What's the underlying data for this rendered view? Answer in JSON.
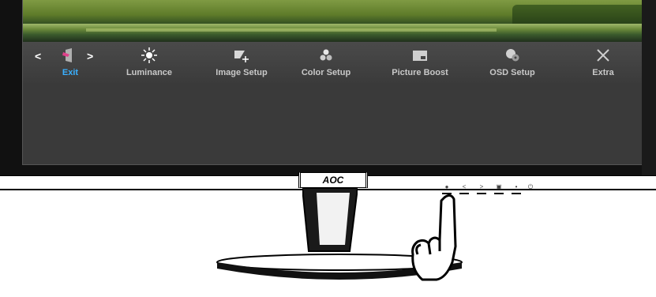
{
  "osd": {
    "menu_items": [
      {
        "label": "Exit",
        "icon": "exit-icon",
        "active": true
      },
      {
        "label": "Luminance",
        "icon": "luminance-icon",
        "active": false
      },
      {
        "label": "Image Setup",
        "icon": "image-setup-icon",
        "active": false
      },
      {
        "label": "Color Setup",
        "icon": "color-setup-icon",
        "active": false
      },
      {
        "label": "Picture Boost",
        "icon": "picture-boost-icon",
        "active": false
      },
      {
        "label": "OSD Setup",
        "icon": "osd-setup-icon",
        "active": false
      },
      {
        "label": "Extra",
        "icon": "extra-icon",
        "active": false
      }
    ],
    "nav_left": "<",
    "nav_right": ">",
    "active_color": "#3ab0ff"
  },
  "monitor": {
    "brand": "AOC",
    "buttons": [
      {
        "glyph": "●",
        "icon": "menu-button-icon"
      },
      {
        "glyph": "<",
        "icon": "left-button-icon"
      },
      {
        "glyph": ">",
        "icon": "right-button-icon"
      },
      {
        "glyph": "▣",
        "icon": "auto-button-icon"
      },
      {
        "glyph": "•",
        "icon": "source-button-icon"
      },
      {
        "glyph": "⏻",
        "icon": "power-button-icon"
      }
    ]
  }
}
